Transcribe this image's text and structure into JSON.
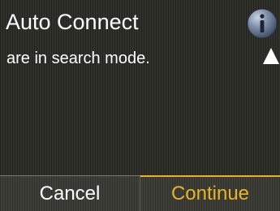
{
  "screen": {
    "title": "Auto Connect",
    "message": "are in search mode."
  },
  "icons": {
    "info": "info-icon",
    "scroll_up": "triangle-up-icon"
  },
  "softkeys": {
    "left_label": "Cancel",
    "right_label": "Continue"
  },
  "colors": {
    "background": "#2b2b25",
    "text": "#ffffff",
    "accent": "#e8b32a"
  }
}
